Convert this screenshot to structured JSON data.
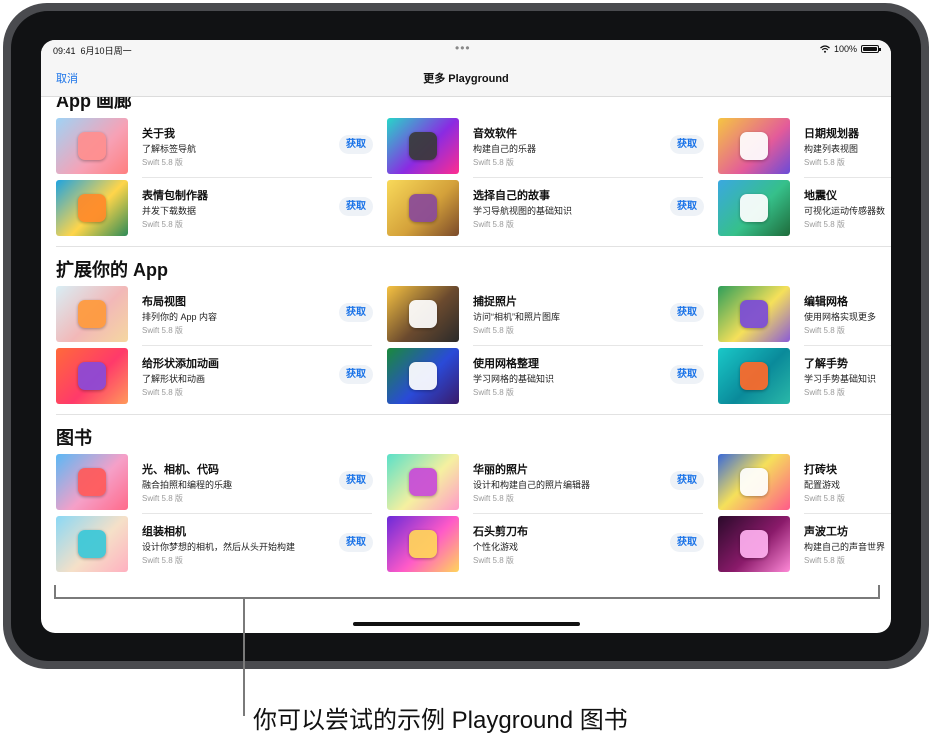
{
  "status": {
    "time": "09:41",
    "date": "6月10日周一",
    "battery": "100%"
  },
  "nav": {
    "cancel": "取消",
    "title": "更多 Playground"
  },
  "get_label": "获取",
  "sections": [
    {
      "title": "App 画廊",
      "items": [
        {
          "title": "关于我",
          "subtitle": "了解标签导航",
          "version": "Swift 5.8 版"
        },
        {
          "title": "音效软件",
          "subtitle": "构建自己的乐器",
          "version": "Swift 5.8 版"
        },
        {
          "title": "日期规划器",
          "subtitle": "构建列表视图",
          "version": "Swift 5.8 版"
        },
        {
          "title": "表情包制作器",
          "subtitle": "并发下载数据",
          "version": "Swift 5.8 版"
        },
        {
          "title": "选择自己的故事",
          "subtitle": "学习导航视图的基础知识",
          "version": "Swift 5.8 版"
        },
        {
          "title": "地震仪",
          "subtitle": "可视化运动传感器数",
          "version": "Swift 5.8 版"
        }
      ]
    },
    {
      "title": "扩展你的 App",
      "items": [
        {
          "title": "布局视图",
          "subtitle": "排列你的 App 内容",
          "version": "Swift 5.8 版"
        },
        {
          "title": "捕捉照片",
          "subtitle": "访问“相机”和照片图库",
          "version": "Swift 5.8 版"
        },
        {
          "title": "编辑网格",
          "subtitle": "使用网格实现更多",
          "version": "Swift 5.8 版"
        },
        {
          "title": "给形状添加动画",
          "subtitle": "了解形状和动画",
          "version": "Swift 5.8 版"
        },
        {
          "title": "使用网格整理",
          "subtitle": "学习网格的基础知识",
          "version": "Swift 5.8 版"
        },
        {
          "title": "了解手势",
          "subtitle": "学习手势基础知识",
          "version": "Swift 5.8 版"
        }
      ]
    },
    {
      "title": "图书",
      "items": [
        {
          "title": "光、相机、代码",
          "subtitle": "融合拍照和编程的乐趣",
          "version": "Swift 5.8 版"
        },
        {
          "title": "华丽的照片",
          "subtitle": "设计和构建自己的照片编辑器",
          "version": "Swift 5.8 版"
        },
        {
          "title": "打砖块",
          "subtitle": "配置游戏",
          "version": "Swift 5.8 版"
        },
        {
          "title": "组装相机",
          "subtitle": "设计你梦想的相机，然后从头开始构建",
          "version": "Swift 5.8 版"
        },
        {
          "title": "石头剪刀布",
          "subtitle": "个性化游戏",
          "version": "Swift 5.8 版"
        },
        {
          "title": "声波工坊",
          "subtitle": "构建自己的声音世界",
          "version": "Swift 5.8 版"
        }
      ]
    }
  ],
  "callout": "你可以尝试的示例 Playground 图书"
}
